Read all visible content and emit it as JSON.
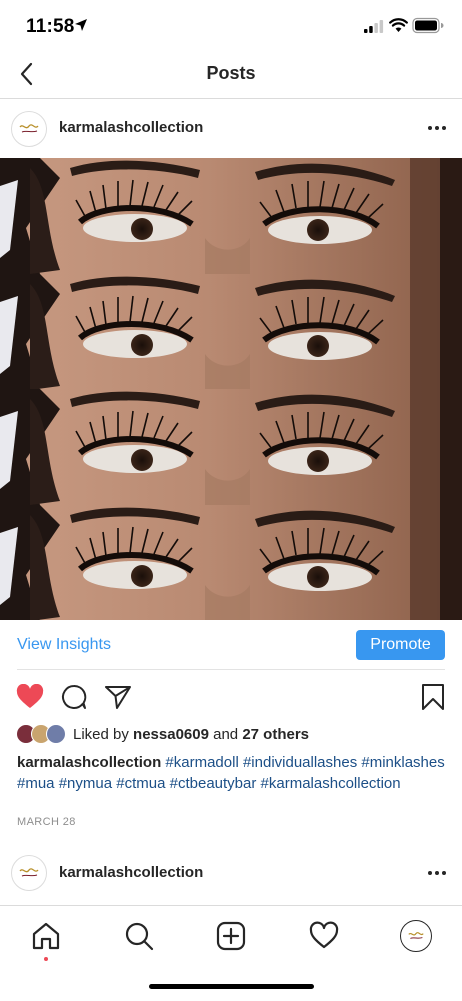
{
  "status_bar": {
    "time": "11:58"
  },
  "nav": {
    "title": "Posts"
  },
  "post": {
    "username": "karmalashcollection",
    "avatar_logo_text": "Karma Lash",
    "view_insights_label": "View Insights",
    "promote_label": "Promote",
    "liked": true,
    "likes": {
      "prefix": "Liked by",
      "user": "nessa0609",
      "joiner": "and",
      "others": "27 others"
    },
    "caption": {
      "username": "karmalashcollection",
      "tags": [
        "#karmadoll",
        "#individuallashes",
        "#minklashes",
        "#mua",
        "#nymua",
        "#ctmua",
        "#ctbeautybar",
        "#karmalashcollection"
      ]
    },
    "date": "MARCH 28"
  },
  "next_post": {
    "username": "karmalashcollection"
  },
  "tab_bar": {
    "items": [
      {
        "icon": "home-icon",
        "active": true
      },
      {
        "icon": "search-icon"
      },
      {
        "icon": "add-post-icon"
      },
      {
        "icon": "activity-heart-icon"
      },
      {
        "icon": "profile-avatar"
      }
    ]
  },
  "colors": {
    "accent": "#3897f0",
    "like_red": "#ed4956",
    "hashtag": "#1c4f87",
    "muted": "#8e8e8e"
  }
}
